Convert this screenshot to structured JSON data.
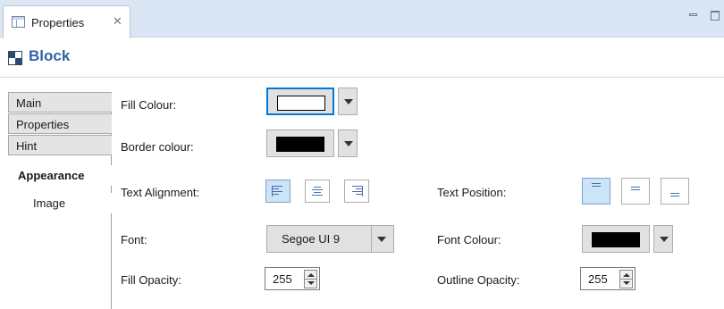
{
  "view_tab": {
    "label": "Properties",
    "close_glyph": "✕"
  },
  "header": {
    "title": "Block"
  },
  "side_tabs": [
    {
      "label": "Main"
    },
    {
      "label": "Properties"
    },
    {
      "label": "Hint"
    },
    {
      "label": "Appearance"
    },
    {
      "label": "Image"
    }
  ],
  "active_tab": "Appearance",
  "fields": {
    "fill_colour": {
      "label": "Fill Colour:",
      "value": "#ffffff"
    },
    "border_colour": {
      "label": "Border colour:",
      "value": "#000000"
    },
    "text_alignment": {
      "label": "Text Alignment:",
      "options": [
        "left",
        "center",
        "right"
      ],
      "selected": "left"
    },
    "text_position": {
      "label": "Text Position:",
      "options": [
        "top",
        "middle",
        "bottom"
      ],
      "selected": "top"
    },
    "font": {
      "label": "Font:",
      "value": "Segoe UI 9"
    },
    "font_colour": {
      "label": "Font Colour:",
      "value": "#000000"
    },
    "fill_opacity": {
      "label": "Fill Opacity:",
      "value": "255"
    },
    "outline_opacity": {
      "label": "Outline Opacity:",
      "value": "255"
    }
  },
  "colors": {
    "accent": "#2f64a8",
    "focus": "#0078d7",
    "tab_bar": "#dae6f3",
    "selected_button": "#cce4f7"
  },
  "icons": [
    "properties-view-icon",
    "close-icon",
    "minimize-icon",
    "maximize-icon",
    "block-icon",
    "chevron-down-icon",
    "align-left-icon",
    "align-center-icon",
    "align-right-icon",
    "position-top-icon",
    "position-middle-icon",
    "position-bottom-icon",
    "spin-up-icon",
    "spin-down-icon"
  ]
}
